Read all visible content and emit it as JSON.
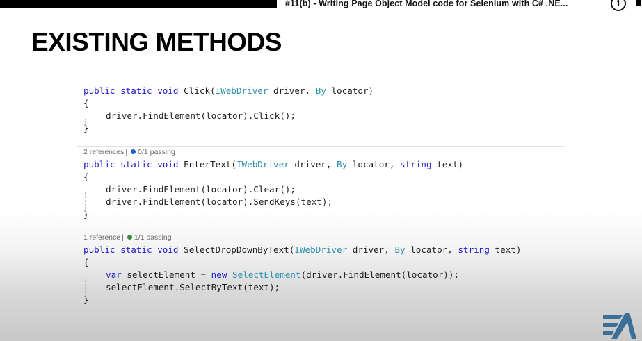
{
  "video": {
    "title": "#11(b) - Writing Page Object Model code for Selenium with C# .NE...",
    "info_icon": "i"
  },
  "slide": {
    "heading": "EXISTING METHODS",
    "methods": [
      {
        "codelens": null,
        "signature": {
          "kw1": "public",
          "kw2": "static",
          "kw3": "void",
          "name": "Click(",
          "p1_type": "IWebDriver",
          "p1_name": " driver, ",
          "p2_type": "By",
          "p2_name": " locator)"
        },
        "open_brace": "{",
        "body": [
          "driver.FindElement(locator).Click();"
        ],
        "close_brace": "}"
      },
      {
        "codelens": {
          "references": "2 references",
          "tests": "0/1 passing",
          "status_color": "#1e5bc6"
        },
        "signature": {
          "kw1": "public",
          "kw2": "static",
          "kw3": "void",
          "name": "EnterText(",
          "p1_type": "IWebDriver",
          "p1_name": " driver, ",
          "p2_type": "By",
          "p2_name": " locator, ",
          "p3_type": "string",
          "p3_name": " text)"
        },
        "open_brace": "{",
        "body": [
          "driver.FindElement(locator).Clear();",
          "driver.FindElement(locator).SendKeys(text);"
        ],
        "close_brace": "}"
      },
      {
        "codelens": {
          "references": "1 reference",
          "tests": "1/1 passing",
          "status_color": "#3a8a3a"
        },
        "signature": {
          "kw1": "public",
          "kw2": "static",
          "kw3": "void",
          "name": "SelectDropDownByText(",
          "p1_type": "IWebDriver",
          "p1_name": " driver, ",
          "p2_type": "By",
          "p2_name": " locator, ",
          "p3_type": "string",
          "p3_name": " text)"
        },
        "open_brace": "{",
        "body_line1": {
          "kw": "var",
          "mid": " selectElement = ",
          "kw_new": "new",
          "sp": " ",
          "cls": "SelectElement",
          "rest": "(driver.FindElement(locator));"
        },
        "body_line2": "selectElement.SelectByText(text);",
        "close_brace": "}"
      }
    ]
  },
  "logo": {
    "name": "EA-logo",
    "color": "#3d6f96"
  }
}
